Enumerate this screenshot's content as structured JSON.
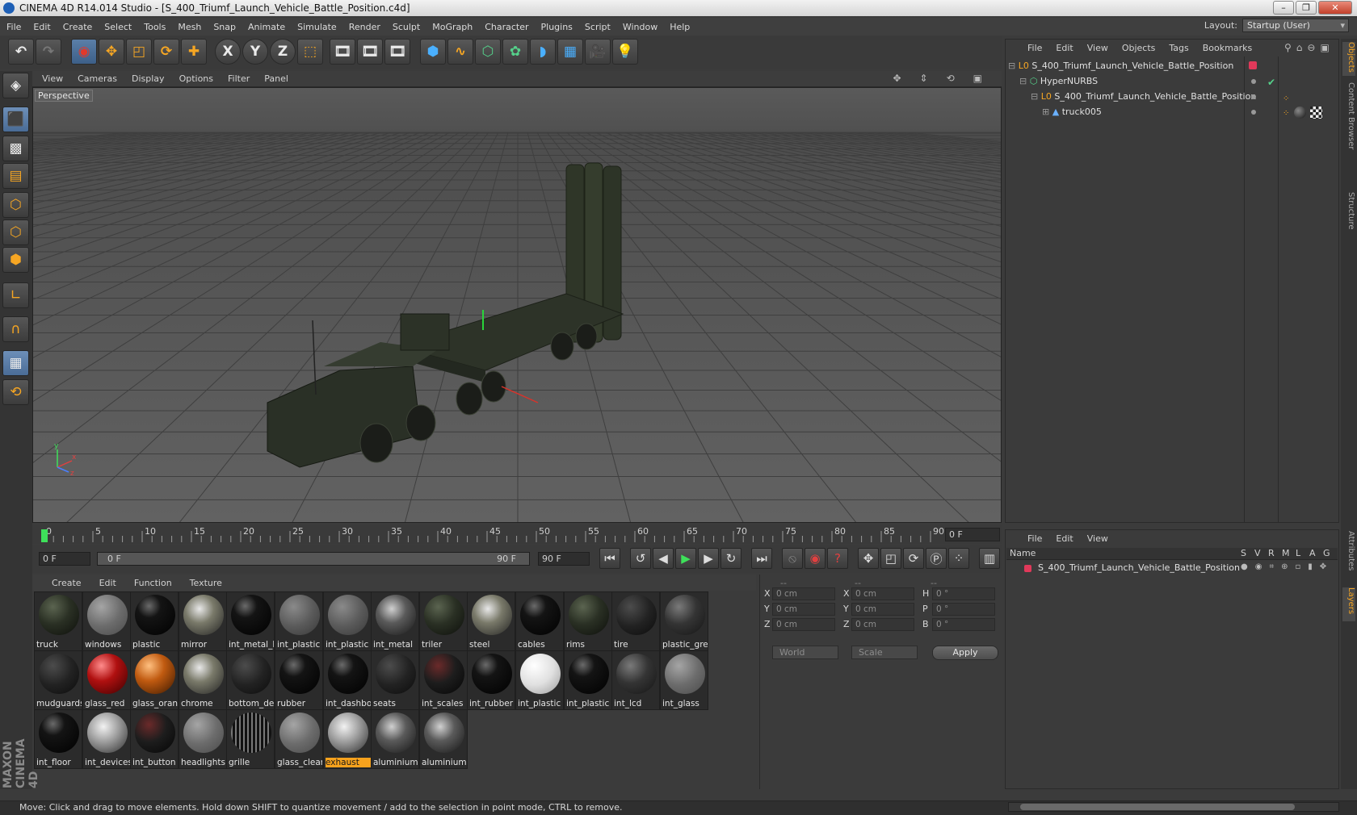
{
  "window": {
    "title": "CINEMA 4D R14.014 Studio - [S_400_Triumf_Launch_Vehicle_Battle_Position.c4d]",
    "controls": [
      "–",
      "❐",
      "✕"
    ]
  },
  "menubar": {
    "items": [
      "File",
      "Edit",
      "Create",
      "Select",
      "Tools",
      "Mesh",
      "Snap",
      "Animate",
      "Simulate",
      "Render",
      "Sculpt",
      "MoGraph",
      "Character",
      "Plugins",
      "Script",
      "Window",
      "Help"
    ],
    "layout_label": "Layout:",
    "layout_value": "Startup (User)"
  },
  "toolbar": {
    "axis_x": "X",
    "axis_y": "Y",
    "axis_z": "Z"
  },
  "viewport": {
    "menu": [
      "View",
      "Cameras",
      "Display",
      "Options",
      "Filter",
      "Panel"
    ],
    "label": "Perspective"
  },
  "timeline": {
    "ticks": [
      "0",
      "5",
      "10",
      "15",
      "20",
      "25",
      "30",
      "35",
      "40",
      "45",
      "50",
      "55",
      "60",
      "65",
      "70",
      "75",
      "80",
      "85",
      "90"
    ],
    "current_frame": "0 F",
    "start_field": "0 F",
    "slider_start": "0 F",
    "slider_end": "90 F",
    "end_field": "90 F"
  },
  "materials": {
    "menu": [
      "Create",
      "Edit",
      "Function",
      "Texture"
    ],
    "selected": "exhaust",
    "items": [
      {
        "name": "truck",
        "style": "dark-green"
      },
      {
        "name": "windows",
        "style": "clear"
      },
      {
        "name": "plastic",
        "style": "black-gloss"
      },
      {
        "name": "mirror",
        "style": "chrome"
      },
      {
        "name": "int_metal_b",
        "style": "black-gloss"
      },
      {
        "name": "int_plastic",
        "style": "grey"
      },
      {
        "name": "int_plastic",
        "style": "grey"
      },
      {
        "name": "int_metal",
        "style": "chrome-dark"
      },
      {
        "name": "triler",
        "style": "dark-green"
      },
      {
        "name": "steel",
        "style": "chrome"
      },
      {
        "name": "cables",
        "style": "black-gloss"
      },
      {
        "name": "rims",
        "style": "dark-green"
      },
      {
        "name": "tire",
        "style": "dark"
      },
      {
        "name": "plastic_gre",
        "style": "grey-dark"
      },
      {
        "name": "mudguards",
        "style": "dark"
      },
      {
        "name": "glass_red",
        "style": "red"
      },
      {
        "name": "glass_oran",
        "style": "orange"
      },
      {
        "name": "chrome",
        "style": "chrome"
      },
      {
        "name": "bottom_de",
        "style": "dark"
      },
      {
        "name": "rubber",
        "style": "black-gloss"
      },
      {
        "name": "int_dashbo",
        "style": "black-gloss"
      },
      {
        "name": "seats",
        "style": "dark"
      },
      {
        "name": "int_scales",
        "style": "scales"
      },
      {
        "name": "int_rubber",
        "style": "black-gloss"
      },
      {
        "name": "int_plastic",
        "style": "white"
      },
      {
        "name": "int_plastic",
        "style": "black-gloss"
      },
      {
        "name": "int_lcd",
        "style": "grey-dark"
      },
      {
        "name": "int_glass",
        "style": "clear"
      },
      {
        "name": "int_floor",
        "style": "black-gloss"
      },
      {
        "name": "int_devices",
        "style": "silver"
      },
      {
        "name": "int_button",
        "style": "scales"
      },
      {
        "name": "headlights",
        "style": "clear"
      },
      {
        "name": "grille",
        "style": "grille"
      },
      {
        "name": "glass_clear",
        "style": "clear"
      },
      {
        "name": "exhaust",
        "style": "silver"
      },
      {
        "name": "aluminium",
        "style": "chrome-dark"
      },
      {
        "name": "aluminium",
        "style": "chrome-dark"
      }
    ]
  },
  "coordinates": {
    "col_headers": [
      "--",
      "--",
      "--"
    ],
    "rows": [
      {
        "l1": "X",
        "v1": "0 cm",
        "l2": "X",
        "v2": "0 cm",
        "l3": "H",
        "v3": "0 °"
      },
      {
        "l1": "Y",
        "v1": "0 cm",
        "l2": "Y",
        "v2": "0 cm",
        "l3": "P",
        "v3": "0 °"
      },
      {
        "l1": "Z",
        "v1": "0 cm",
        "l2": "Z",
        "v2": "0 cm",
        "l3": "B",
        "v3": "0 °"
      }
    ],
    "space": "World",
    "mode": "Scale",
    "apply": "Apply"
  },
  "objects": {
    "menu": [
      "File",
      "Edit",
      "View",
      "Objects",
      "Tags",
      "Bookmarks"
    ],
    "items": [
      {
        "name": "S_400_Triumf_Launch_Vehicle_Battle_Position"
      },
      {
        "name": "HyperNURBS"
      },
      {
        "name": "S_400_Triumf_Launch_Vehicle_Battle_Position"
      },
      {
        "name": "truck005"
      }
    ]
  },
  "layers": {
    "menu": [
      "File",
      "Edit",
      "View"
    ],
    "header_name": "Name",
    "header_flags": [
      "S",
      "V",
      "R",
      "M",
      "L",
      "A",
      "G"
    ],
    "items": [
      {
        "name": "S_400_Triumf_Launch_Vehicle_Battle_Position",
        "color": "#e0395a"
      }
    ]
  },
  "sidetabs": [
    "Objects",
    "Content Browser",
    "Structure",
    "Attributes",
    "Layers"
  ],
  "status": "Move: Click and drag to move elements. Hold down SHIFT to quantize movement / add to the selection in point mode, CTRL to remove.",
  "logo": [
    "MAXON",
    "CINEMA 4D"
  ]
}
